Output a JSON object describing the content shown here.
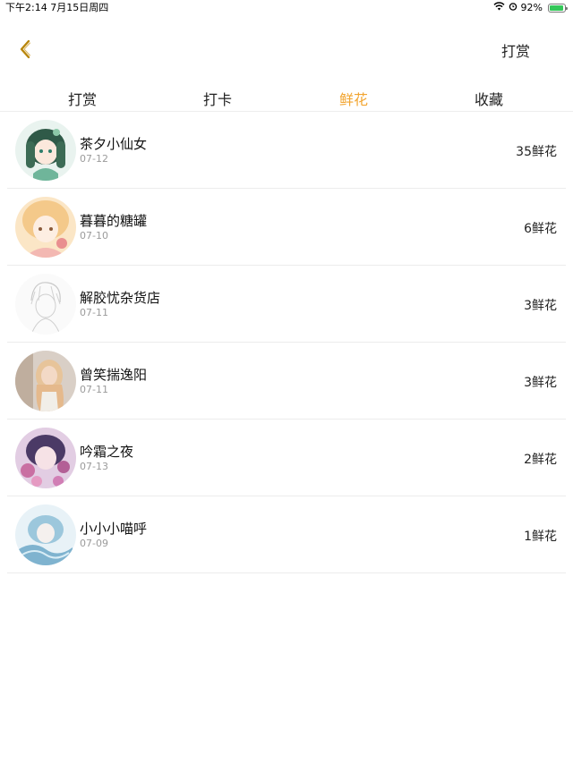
{
  "status": {
    "time_date": "下午2:14   7月15日周四",
    "battery": "92%",
    "battery_level": 0.92
  },
  "nav": {
    "right_label": "打赏"
  },
  "tabs": [
    {
      "label": "打赏",
      "active": false
    },
    {
      "label": "打卡",
      "active": false
    },
    {
      "label": "鲜花",
      "active": true
    },
    {
      "label": "收藏",
      "active": false
    }
  ],
  "colors": {
    "accent": "#f2a531",
    "back_arrow": "#b8860b"
  },
  "items": [
    {
      "name": "茶夕小仙女",
      "date": "07-12",
      "count": "35鲜花",
      "avatar": "anime-girl-green-hair"
    },
    {
      "name": "暮暮的糖罐",
      "date": "07-10",
      "count": "6鲜花",
      "avatar": "anime-girl-light-hair"
    },
    {
      "name": "解胶忧杂货店",
      "date": "07-11",
      "count": "3鲜花",
      "avatar": "sketch-boy"
    },
    {
      "name": "曾笑揣逸阳",
      "date": "07-11",
      "count": "3鲜花",
      "avatar": "girl-blonde-photo"
    },
    {
      "name": "吟霜之夜",
      "date": "07-13",
      "count": "2鲜花",
      "avatar": "anime-girl-purple-flowers"
    },
    {
      "name": "小小小喵呼",
      "date": "07-09",
      "count": "1鲜花",
      "avatar": "anime-girl-blue-water"
    }
  ]
}
